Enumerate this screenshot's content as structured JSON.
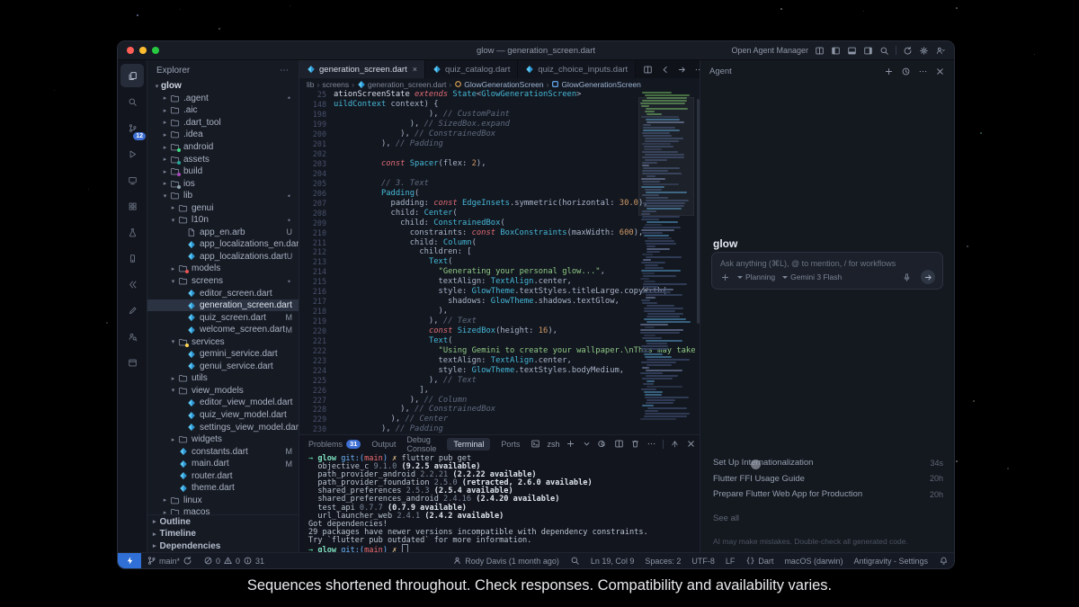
{
  "caption": "Sequences shortened throughout. Check responses. Compatibility and availability varies.",
  "window": {
    "title": "glow — generation_screen.dart"
  },
  "titlebar": {
    "agent_manager": "Open Agent Manager"
  },
  "activity_bar": {
    "items": [
      {
        "icon": "files",
        "active": true
      },
      {
        "icon": "search"
      },
      {
        "icon": "source-control",
        "badge": "12"
      },
      {
        "icon": "run-debug"
      },
      {
        "icon": "remote-window"
      },
      {
        "icon": "extensions"
      },
      {
        "icon": "testing"
      },
      {
        "icon": "mobile-device"
      },
      {
        "icon": "flutter"
      },
      {
        "icon": "pen"
      },
      {
        "icon": "agent-search"
      },
      {
        "icon": "preview-window"
      }
    ]
  },
  "explorer": {
    "title": "Explorer",
    "more": "⋯",
    "tree": [
      {
        "label": "glow",
        "depth": 0,
        "kind": "root",
        "chev": "v",
        "bold": true
      },
      {
        "label": ".agent",
        "depth": 1,
        "kind": "folder",
        "chev": ">",
        "rdot": true
      },
      {
        "label": ".aic",
        "depth": 1,
        "kind": "folder",
        "chev": ">"
      },
      {
        "label": ".dart_tool",
        "depth": 1,
        "kind": "folder",
        "chev": ">"
      },
      {
        "label": ".idea",
        "depth": 1,
        "kind": "folder",
        "chev": ">"
      },
      {
        "label": "android",
        "depth": 1,
        "kind": "folder",
        "chev": ">",
        "fdot": "#3ddc84"
      },
      {
        "label": "assets",
        "depth": 1,
        "kind": "folder",
        "chev": ">",
        "fdot": "#26a69a"
      },
      {
        "label": "build",
        "depth": 1,
        "kind": "folder",
        "chev": ">",
        "fdot": "#ab47bc"
      },
      {
        "label": "ios",
        "depth": 1,
        "kind": "folder",
        "chev": ">",
        "fdot": "#90a4ae"
      },
      {
        "label": "lib",
        "depth": 1,
        "kind": "folder",
        "chev": "v",
        "rdot": true
      },
      {
        "label": "genui",
        "depth": 2,
        "kind": "folder",
        "chev": ">"
      },
      {
        "label": "l10n",
        "depth": 2,
        "kind": "folder",
        "chev": "v",
        "rdot": true
      },
      {
        "label": "app_en.arb",
        "depth": 3,
        "kind": "file",
        "badge": "U"
      },
      {
        "label": "app_localizations_en.dart",
        "depth": 3,
        "kind": "dart",
        "badge": "U"
      },
      {
        "label": "app_localizations.dart",
        "depth": 3,
        "kind": "dart",
        "badge": "U"
      },
      {
        "label": "models",
        "depth": 2,
        "kind": "folder",
        "chev": ">",
        "fdot": "#ef5350"
      },
      {
        "label": "screens",
        "depth": 2,
        "kind": "folder",
        "chev": "v",
        "rdot": true
      },
      {
        "label": "editor_screen.dart",
        "depth": 3,
        "kind": "dart"
      },
      {
        "label": "generation_screen.dart",
        "depth": 3,
        "kind": "dart",
        "selected": true
      },
      {
        "label": "quiz_screen.dart",
        "depth": 3,
        "kind": "dart",
        "badge": "M"
      },
      {
        "label": "welcome_screen.dart",
        "depth": 3,
        "kind": "dart",
        "badge": "M"
      },
      {
        "label": "services",
        "depth": 2,
        "kind": "folder",
        "chev": "v",
        "fdot": "#ffd54f"
      },
      {
        "label": "gemini_service.dart",
        "depth": 3,
        "kind": "dart"
      },
      {
        "label": "genui_service.dart",
        "depth": 3,
        "kind": "dart"
      },
      {
        "label": "utils",
        "depth": 2,
        "kind": "folder",
        "chev": ">"
      },
      {
        "label": "view_models",
        "depth": 2,
        "kind": "folder",
        "chev": "v"
      },
      {
        "label": "editor_view_model.dart",
        "depth": 3,
        "kind": "dart"
      },
      {
        "label": "quiz_view_model.dart",
        "depth": 3,
        "kind": "dart"
      },
      {
        "label": "settings_view_model.dart",
        "depth": 3,
        "kind": "dart"
      },
      {
        "label": "widgets",
        "depth": 2,
        "kind": "folder",
        "chev": ">"
      },
      {
        "label": "constants.dart",
        "depth": 2,
        "kind": "dart",
        "badge": "M"
      },
      {
        "label": "main.dart",
        "depth": 2,
        "kind": "dart",
        "badge": "M"
      },
      {
        "label": "router.dart",
        "depth": 2,
        "kind": "dart"
      },
      {
        "label": "theme.dart",
        "depth": 2,
        "kind": "dart"
      },
      {
        "label": "linux",
        "depth": 1,
        "kind": "folder",
        "chev": ">"
      },
      {
        "label": "macos",
        "depth": 1,
        "kind": "folder",
        "chev": ">"
      }
    ],
    "sections": [
      "Outline",
      "Timeline",
      "Dependencies"
    ]
  },
  "tabs": [
    {
      "label": "generation_screen.dart",
      "active": true,
      "close": "×"
    },
    {
      "label": "quiz_catalog.dart"
    },
    {
      "label": "quiz_choice_inputs.dart"
    }
  ],
  "breadcrumb": [
    {
      "label": "lib"
    },
    {
      "label": "screens"
    },
    {
      "label": "generation_screen.dart",
      "icon": "dart"
    },
    {
      "label": "GlowGenerationScreen",
      "icon": "class-orange"
    },
    {
      "label": "GlowGenerationScreen",
      "icon": "class-blue"
    }
  ],
  "editor": {
    "lines": [
      {
        "n": "25",
        "tok": [
          [
            "w",
            "ationScreenState "
          ],
          [
            "k",
            "extends "
          ],
          [
            "t",
            "State"
          ],
          [
            "p",
            "<"
          ],
          [
            "t",
            "GlowGenerationScreen"
          ],
          [
            "p",
            ">"
          ]
        ]
      },
      {
        "n": "148",
        "tok": [
          [
            "t",
            "uildContext"
          ],
          [
            "p",
            " context) {"
          ]
        ]
      },
      {
        "n": "198",
        "tok": [
          [
            "p",
            "                    ), "
          ],
          [
            "c",
            "// CustomPaint"
          ]
        ]
      },
      {
        "n": "199",
        "tok": [
          [
            "p",
            "                ), "
          ],
          [
            "c",
            "// SizedBox.expand"
          ]
        ]
      },
      {
        "n": "200",
        "tok": [
          [
            "p",
            "              ), "
          ],
          [
            "c",
            "// ConstrainedBox"
          ]
        ]
      },
      {
        "n": "201",
        "tok": [
          [
            "p",
            "          ), "
          ],
          [
            "c",
            "// Padding"
          ]
        ]
      },
      {
        "n": "202",
        "tok": []
      },
      {
        "n": "203",
        "tok": [
          [
            "p",
            "          "
          ],
          [
            "k",
            "const "
          ],
          [
            "t",
            "Spacer"
          ],
          [
            "p",
            "(flex: "
          ],
          [
            "n",
            "2"
          ],
          [
            "p",
            "),"
          ]
        ]
      },
      {
        "n": "204",
        "tok": []
      },
      {
        "n": "205",
        "tok": [
          [
            "c",
            "          // 3. Text"
          ]
        ]
      },
      {
        "n": "206",
        "tok": [
          [
            "p",
            "          "
          ],
          [
            "t",
            "Padding"
          ],
          [
            "p",
            "("
          ]
        ]
      },
      {
        "n": "207",
        "tok": [
          [
            "p",
            "            padding: "
          ],
          [
            "k",
            "const "
          ],
          [
            "t",
            "EdgeInsets"
          ],
          [
            "p",
            ".symmetric(horizontal: "
          ],
          [
            "n",
            "30.0"
          ],
          [
            "p",
            "),"
          ]
        ]
      },
      {
        "n": "208",
        "tok": [
          [
            "p",
            "            child: "
          ],
          [
            "t",
            "Center"
          ],
          [
            "p",
            "("
          ]
        ]
      },
      {
        "n": "209",
        "tok": [
          [
            "p",
            "              child: "
          ],
          [
            "t",
            "ConstrainedBox"
          ],
          [
            "p",
            "("
          ]
        ]
      },
      {
        "n": "210",
        "tok": [
          [
            "p",
            "                constraints: "
          ],
          [
            "k",
            "const "
          ],
          [
            "t",
            "BoxConstraints"
          ],
          [
            "p",
            "(maxWidth: "
          ],
          [
            "n",
            "600"
          ],
          [
            "p",
            "),"
          ]
        ]
      },
      {
        "n": "211",
        "tok": [
          [
            "p",
            "                child: "
          ],
          [
            "t",
            "Column"
          ],
          [
            "p",
            "("
          ]
        ]
      },
      {
        "n": "212",
        "tok": [
          [
            "p",
            "                  children: ["
          ]
        ]
      },
      {
        "n": "213",
        "tok": [
          [
            "p",
            "                    "
          ],
          [
            "t",
            "Text"
          ],
          [
            "p",
            "("
          ]
        ]
      },
      {
        "n": "214",
        "tok": [
          [
            "p",
            "                      "
          ],
          [
            "s",
            "\"Generating your personal glow...\""
          ],
          [
            "p",
            ","
          ]
        ]
      },
      {
        "n": "215",
        "tok": [
          [
            "p",
            "                      textAlign: "
          ],
          [
            "t",
            "TextAlign"
          ],
          [
            "p",
            ".center,"
          ]
        ]
      },
      {
        "n": "216",
        "tok": [
          [
            "p",
            "                      style: "
          ],
          [
            "t",
            "GlowTheme"
          ],
          [
            "p",
            ".textStyles.titleLarge.copyWith("
          ]
        ]
      },
      {
        "n": "217",
        "tok": [
          [
            "p",
            "                        shadows: "
          ],
          [
            "t",
            "GlowTheme"
          ],
          [
            "p",
            ".shadows.textGlow,"
          ]
        ]
      },
      {
        "n": "218",
        "tok": [
          [
            "p",
            "                      ),"
          ]
        ]
      },
      {
        "n": "219",
        "tok": [
          [
            "p",
            "                    ), "
          ],
          [
            "c",
            "// Text"
          ]
        ]
      },
      {
        "n": "220",
        "tok": [
          [
            "p",
            "                    "
          ],
          [
            "k",
            "const "
          ],
          [
            "t",
            "SizedBox"
          ],
          [
            "p",
            "(height: "
          ],
          [
            "n",
            "16"
          ],
          [
            "p",
            "),"
          ]
        ]
      },
      {
        "n": "221",
        "tok": [
          [
            "p",
            "                    "
          ],
          [
            "t",
            "Text"
          ],
          [
            "p",
            "("
          ]
        ]
      },
      {
        "n": "222",
        "tok": [
          [
            "p",
            "                      "
          ],
          [
            "s",
            "\"Using Gemini to create your wallpaper.\\nThis may take a mome"
          ]
        ]
      },
      {
        "n": "223",
        "tok": [
          [
            "p",
            "                      textAlign: "
          ],
          [
            "t",
            "TextAlign"
          ],
          [
            "p",
            ".center,"
          ]
        ]
      },
      {
        "n": "224",
        "tok": [
          [
            "p",
            "                      style: "
          ],
          [
            "t",
            "GlowTheme"
          ],
          [
            "p",
            ".textStyles.bodyMedium,"
          ]
        ]
      },
      {
        "n": "225",
        "tok": [
          [
            "p",
            "                    ), "
          ],
          [
            "c",
            "// Text"
          ]
        ]
      },
      {
        "n": "226",
        "tok": [
          [
            "p",
            "                  ],"
          ]
        ]
      },
      {
        "n": "227",
        "tok": [
          [
            "p",
            "                ), "
          ],
          [
            "c",
            "// Column"
          ]
        ]
      },
      {
        "n": "228",
        "tok": [
          [
            "p",
            "              ), "
          ],
          [
            "c",
            "// ConstrainedBox"
          ]
        ]
      },
      {
        "n": "229",
        "tok": [
          [
            "p",
            "            ), "
          ],
          [
            "c",
            "// Center"
          ]
        ]
      },
      {
        "n": "230",
        "tok": [
          [
            "p",
            "          ), "
          ],
          [
            "c",
            "// Padding"
          ]
        ]
      }
    ]
  },
  "panel": {
    "tabs": [
      {
        "label": "Problems",
        "badge": "31"
      },
      {
        "label": "Output"
      },
      {
        "label": "Debug Console"
      },
      {
        "label": "Terminal",
        "active": true
      },
      {
        "label": "Ports"
      }
    ],
    "shell": "zsh",
    "terminal": [
      {
        "tok": [
          [
            "ar",
            "→ "
          ],
          [
            "g",
            "glow "
          ],
          [
            "bl",
            "git:("
          ],
          [
            "rd",
            "main"
          ],
          [
            "bl",
            ") "
          ],
          [
            "yl",
            "✗ "
          ],
          [
            "p",
            "flutter pub get"
          ]
        ]
      },
      {
        "tok": [
          [
            "p",
            "  objective_c "
          ],
          [
            "d",
            "9.1.0 "
          ],
          [
            "b",
            "(9.2.5 available)"
          ]
        ]
      },
      {
        "tok": [
          [
            "p",
            "  path_provider_android "
          ],
          [
            "d",
            "2.2.21 "
          ],
          [
            "b",
            "(2.2.22 available)"
          ]
        ]
      },
      {
        "tok": [
          [
            "p",
            "  path_provider_foundation "
          ],
          [
            "d",
            "2.5.0 "
          ],
          [
            "b",
            "(retracted, 2.6.0 available)"
          ]
        ]
      },
      {
        "tok": [
          [
            "p",
            "  shared_preferences "
          ],
          [
            "d",
            "2.5.3 "
          ],
          [
            "b",
            "(2.5.4 available)"
          ]
        ]
      },
      {
        "tok": [
          [
            "p",
            "  shared_preferences_android "
          ],
          [
            "d",
            "2.4.16 "
          ],
          [
            "b",
            "(2.4.20 available)"
          ]
        ]
      },
      {
        "tok": [
          [
            "p",
            "  test_api "
          ],
          [
            "d",
            "0.7.7 "
          ],
          [
            "b",
            "(0.7.9 available)"
          ]
        ]
      },
      {
        "tok": [
          [
            "p",
            "  url_launcher_web "
          ],
          [
            "d",
            "2.4.1 "
          ],
          [
            "b",
            "(2.4.2 available)"
          ]
        ]
      },
      {
        "tok": [
          [
            "p",
            "Got dependencies!"
          ]
        ]
      },
      {
        "tok": [
          [
            "p",
            "29 packages have newer versions incompatible with dependency constraints."
          ]
        ]
      },
      {
        "tok": [
          [
            "p",
            "Try `flutter pub outdated` for more information."
          ]
        ]
      },
      {
        "tok": [
          [
            "ar",
            "→ "
          ],
          [
            "g",
            "glow "
          ],
          [
            "bl",
            "git:("
          ],
          [
            "rd",
            "main"
          ],
          [
            "bl",
            ") "
          ],
          [
            "yl",
            "✗ "
          ],
          [
            "cur",
            ""
          ]
        ]
      }
    ]
  },
  "agent": {
    "header": "Agent",
    "title": "glow",
    "placeholder": "Ask anything (⌘L), @ to mention, / for workflows",
    "mode": "Planning",
    "model": "Gemini 3 Flash",
    "tasks": [
      {
        "title": "Set Up Internationalization",
        "time": "34s"
      },
      {
        "title": "Flutter FFI Usage Guide",
        "time": "20h"
      },
      {
        "title": "Prepare Flutter Web App for Production",
        "time": "20h"
      }
    ],
    "see_all": "See all",
    "disclaimer": "AI may make mistakes. Double-check all generated code."
  },
  "status_bar": {
    "branch": "main*",
    "errors": "0",
    "warnings": "0",
    "infos": "31",
    "right": [
      {
        "icon": "person",
        "label": "Rody Davis (1 month ago)"
      },
      {
        "icon": "search",
        "label": ""
      },
      {
        "label": "Ln 19, Col 9"
      },
      {
        "label": "Spaces: 2"
      },
      {
        "label": "UTF-8"
      },
      {
        "label": "LF"
      },
      {
        "icon": "braces",
        "label": "Dart"
      },
      {
        "label": "macOS (darwin)"
      },
      {
        "label": "Antigravity - Settings"
      },
      {
        "icon": "bell",
        "label": ""
      }
    ]
  }
}
